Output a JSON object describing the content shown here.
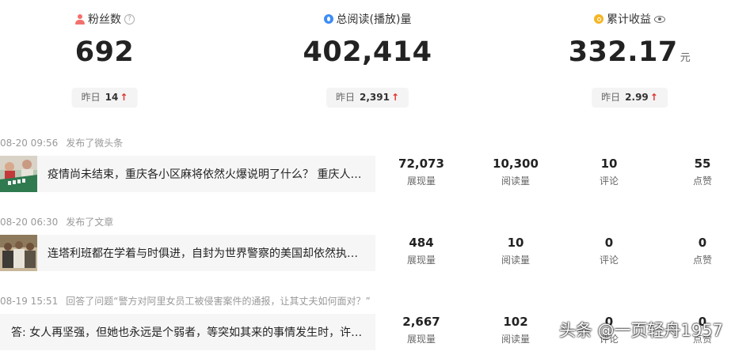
{
  "stats": [
    {
      "label": "粉丝数",
      "value": "692",
      "unit": "",
      "delta_label": "昨日",
      "delta": "14",
      "arrow": "↑"
    },
    {
      "label": "总阅读(播放)量",
      "value": "402,414",
      "unit": "",
      "delta_label": "昨日",
      "delta": "2,391",
      "arrow": "↑"
    },
    {
      "label": "累计收益",
      "value": "332.17",
      "unit": "元",
      "delta_label": "昨日",
      "delta": "2.99",
      "arrow": "↑"
    }
  ],
  "feed": [
    {
      "time": "08-20 09:56",
      "action": "发布了微头条",
      "title": "疫情尚未结束，重庆各小区麻将依然火爆说明了什么？ 重庆人…",
      "metrics": [
        {
          "num": "72,073",
          "label": "展现量"
        },
        {
          "num": "10,300",
          "label": "阅读量"
        },
        {
          "num": "10",
          "label": "评论"
        },
        {
          "num": "55",
          "label": "点赞"
        }
      ]
    },
    {
      "time": "08-20 06:30",
      "action": "发布了文章",
      "title": "连塔利班都在学着与时俱进，自封为世界警察的美国却依然执…",
      "metrics": [
        {
          "num": "484",
          "label": "展现量"
        },
        {
          "num": "10",
          "label": "阅读量"
        },
        {
          "num": "0",
          "label": "评论"
        },
        {
          "num": "0",
          "label": "点赞"
        }
      ]
    },
    {
      "time": "08-19 15:51",
      "action": "回答了问题“警方对阿里女员工被侵害案件的通报，让其丈夫如何面对？”",
      "title": "答: 女人再坚强，但她也永远是个弱者，等突如其来的事情发生时，许…",
      "metrics": [
        {
          "num": "2,667",
          "label": "展现量"
        },
        {
          "num": "102",
          "label": "阅读量"
        },
        {
          "num": "0",
          "label": "评论"
        },
        {
          "num": "0",
          "label": "点赞"
        }
      ]
    }
  ],
  "watermark": "头条 @一页轻舟1957"
}
